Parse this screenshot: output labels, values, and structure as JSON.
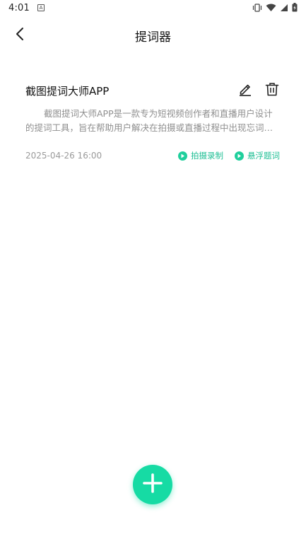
{
  "status_bar": {
    "time": "4:01",
    "notification_icon": "A",
    "icons": [
      "vibrate-icon",
      "wifi-icon",
      "signal-icon",
      "battery-charging-icon"
    ]
  },
  "header": {
    "back_icon": "chevron-left-icon",
    "title": "提词器"
  },
  "scripts": [
    {
      "title": "截图提词大师APP",
      "description": "截图提词大师APP是一款专为短视频创作者和直播用户设计的提词工具，旨在帮助用户解决在拍摄或直播过程中出现忘词等问题。",
      "date": "2025-04-26 16:00",
      "edit_icon": "pencil-icon",
      "delete_icon": "trash-icon",
      "action_record": "拍摄录制",
      "action_float": "悬浮题词"
    }
  ],
  "fab": {
    "icon": "plus-icon"
  },
  "colors": {
    "accent": "#1fbf94",
    "fab": "#16dba4",
    "text_primary": "#111111",
    "text_secondary": "#8f8f8f"
  }
}
